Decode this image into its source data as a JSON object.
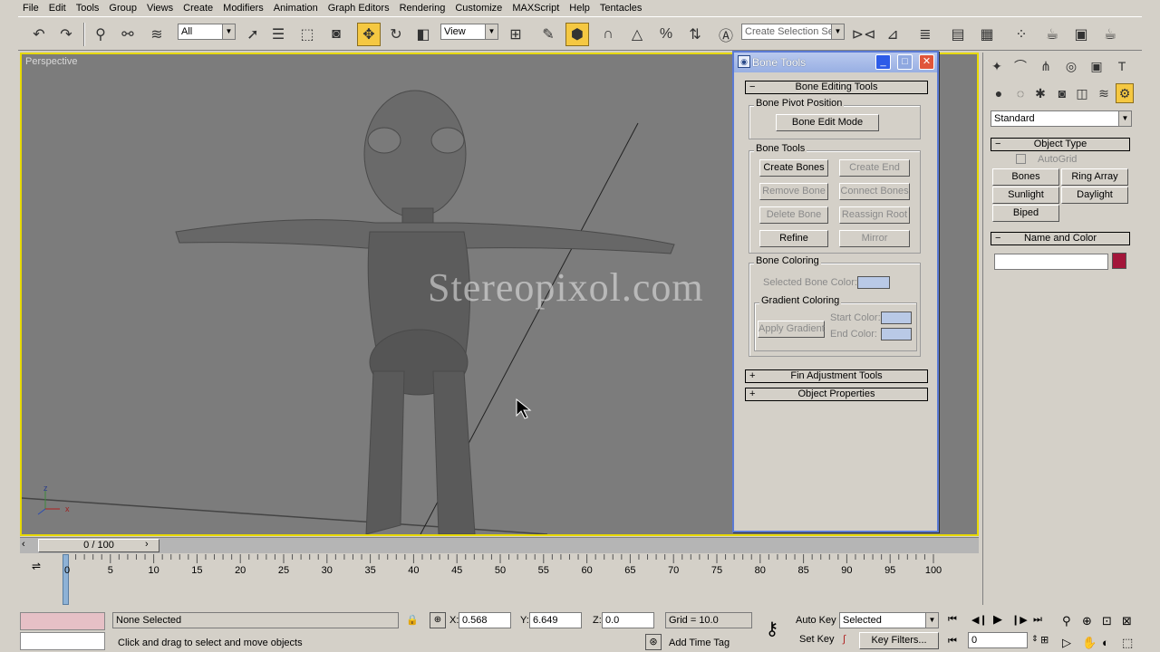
{
  "menu": [
    "File",
    "Edit",
    "Tools",
    "Group",
    "Views",
    "Create",
    "Modifiers",
    "Animation",
    "Graph Editors",
    "Rendering",
    "Customize",
    "MAXScript",
    "Help",
    "Tentacles"
  ],
  "toolbar": {
    "filter_select": "All",
    "refcoord_select": "View",
    "selection_set": "Create Selection Set"
  },
  "viewport": {
    "label": "Perspective",
    "watermark": "Stereopixol.com",
    "axis_z": "z",
    "axis_x": "x"
  },
  "bone_tools": {
    "title": "Bone Tools",
    "rollout_editing": "Bone Editing Tools",
    "group_pivot": "Bone Pivot Position",
    "bone_edit_mode": "Bone Edit Mode",
    "group_tools": "Bone Tools",
    "create_bones": "Create Bones",
    "create_end": "Create End",
    "remove_bone": "Remove Bone",
    "connect_bones": "Connect Bones",
    "delete_bone": "Delete Bone",
    "reassign_root": "Reassign Root",
    "refine": "Refine",
    "mirror": "Mirror",
    "group_coloring": "Bone Coloring",
    "selected_bone_color": "Selected Bone Color:",
    "group_gradient": "Gradient Coloring",
    "apply_gradient": "Apply Gradient",
    "start_color": "Start Color:",
    "end_color": "End Color:",
    "rollout_fin": "Fin Adjustment Tools",
    "rollout_props": "Object Properties",
    "swatch_color": "#b9c9e6"
  },
  "command_panel": {
    "category": "Standard",
    "rollout_object_type": "Object Type",
    "autogrid": "AutoGrid",
    "bones": "Bones",
    "ring_array": "Ring Array",
    "sunlight": "Sunlight",
    "daylight": "Daylight",
    "biped": "Biped",
    "rollout_name_color": "Name and Color",
    "object_name": "",
    "object_color": "#a3163a"
  },
  "timeline": {
    "frame_display": "0 / 100",
    "ticks": [
      "0",
      "5",
      "10",
      "15",
      "20",
      "25",
      "30",
      "35",
      "40",
      "45",
      "50",
      "55",
      "60",
      "65",
      "70",
      "75",
      "80",
      "85",
      "90",
      "95",
      "100"
    ]
  },
  "status": {
    "selection": "None Selected",
    "prompt": "Click and drag to select and move objects",
    "x_label": "X:",
    "x_value": "0.568",
    "y_label": "Y:",
    "y_value": "6.649",
    "z_label": "Z:",
    "z_value": "0.0",
    "grid": "Grid = 10.0",
    "add_time_tag": "Add Time Tag",
    "auto_key": "Auto Key",
    "set_key": "Set Key",
    "key_mode": "Selected",
    "key_filters": "Key Filters...",
    "current_frame": "0"
  }
}
